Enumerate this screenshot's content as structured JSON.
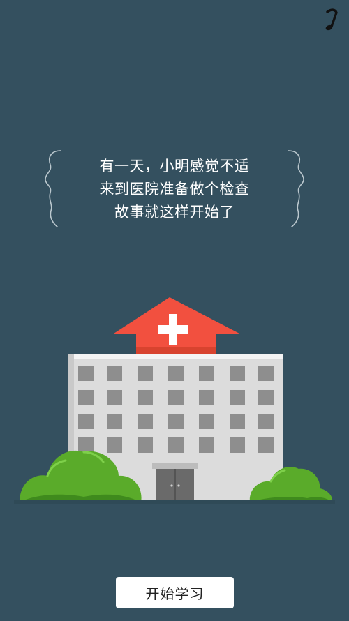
{
  "screen": {
    "background_color": "#34505f"
  },
  "music_toggle": {
    "icon": "music-note-icon",
    "color": "#111111"
  },
  "story": {
    "lines": [
      "有一天，小明感觉不适",
      "来到医院准备做个检查",
      "故事就这样开始了"
    ]
  },
  "illustration": {
    "subject": "hospital-building",
    "accent_red": "#f2503f",
    "bush_green": "#5aab2a",
    "building_gray": "#dedede"
  },
  "start_button": {
    "label": "开始学习"
  }
}
